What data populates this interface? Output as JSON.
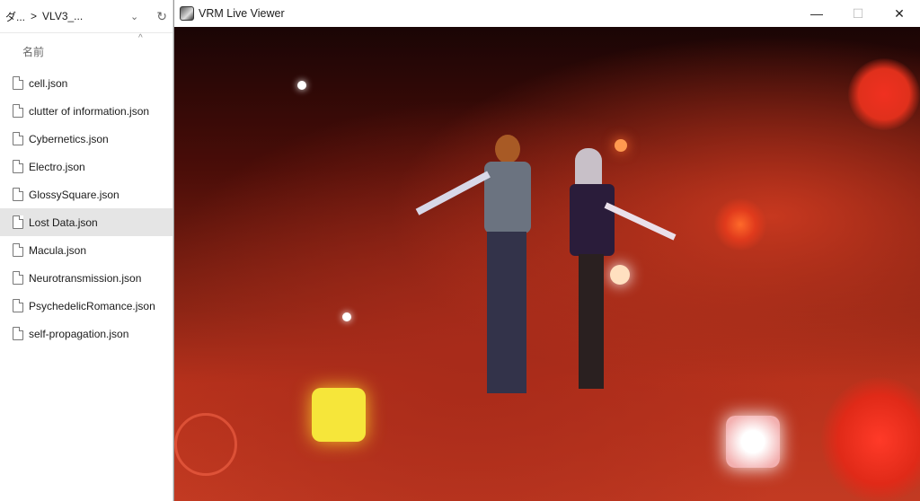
{
  "explorer": {
    "breadcrumb_root": "ダ...",
    "breadcrumb_sep": ">",
    "breadcrumb_folder": "VLV3_...",
    "column_name": "名前",
    "files": [
      {
        "name": "cell.json"
      },
      {
        "name": "clutter of information.json"
      },
      {
        "name": "Cybernetics.json"
      },
      {
        "name": "Electro.json"
      },
      {
        "name": "GlossySquare.json"
      },
      {
        "name": "Lost Data.json",
        "selected": true
      },
      {
        "name": "Macula.json"
      },
      {
        "name": "Neurotransmission.json"
      },
      {
        "name": "PsychedelicRomance.json"
      },
      {
        "name": "self-propagation.json"
      }
    ]
  },
  "window": {
    "title": "VRM Live Viewer",
    "minimize": "—",
    "maximize": "☐",
    "close": "✕"
  }
}
